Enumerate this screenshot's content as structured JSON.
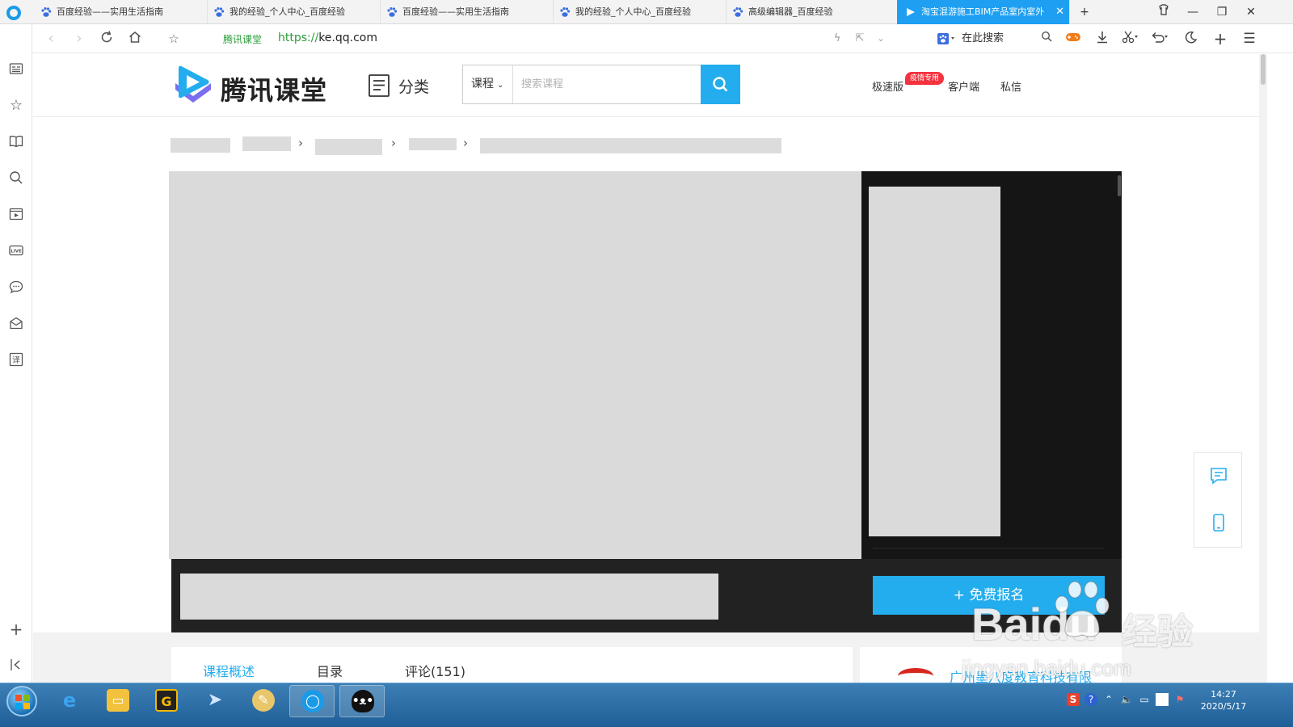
{
  "browser": {
    "tabs": [
      {
        "title": "百度经验——实用生活指南",
        "active": false
      },
      {
        "title": "我的经验_个人中心_百度经验",
        "active": false
      },
      {
        "title": "百度经验——实用生活指南",
        "active": false
      },
      {
        "title": "我的经验_个人中心_百度经验",
        "active": false
      },
      {
        "title": "高级编辑器_百度经验",
        "active": false
      },
      {
        "title": "淘宝混游施工BIM产品室内室外",
        "active": true
      }
    ],
    "new_tab": "+",
    "site_name": "腾讯课堂",
    "url_scheme": "https://",
    "url_host": "ke.qq.com",
    "search_placeholder": "在此搜索"
  },
  "site": {
    "brand": "腾讯课堂",
    "category_label": "分类",
    "search_type": "课程",
    "search_placeholder": "搜索课程",
    "links": {
      "lite": "极速版",
      "lite_badge": "疫情专用",
      "client": "客户端",
      "messages": "私信"
    }
  },
  "course": {
    "enroll_button": "+ 免费报名",
    "tabs": [
      {
        "label": "课程概述",
        "active": true
      },
      {
        "label": "目录",
        "active": false
      },
      {
        "label": "评论(151)",
        "active": false
      }
    ],
    "org_name": "广州墨八度教育科技有限"
  },
  "watermark": {
    "brand": "Baidu",
    "brand_cn": "经验",
    "url": "jingyan.baidu.com"
  },
  "taskbar": {
    "time": "14:27",
    "date": "2020/5/17"
  },
  "colors": {
    "accent": "#23adee",
    "tab_active": "#1e9ff2",
    "url_green": "#2a9d3a",
    "badge_red": "#f5333f",
    "dark_panel": "#151515"
  }
}
